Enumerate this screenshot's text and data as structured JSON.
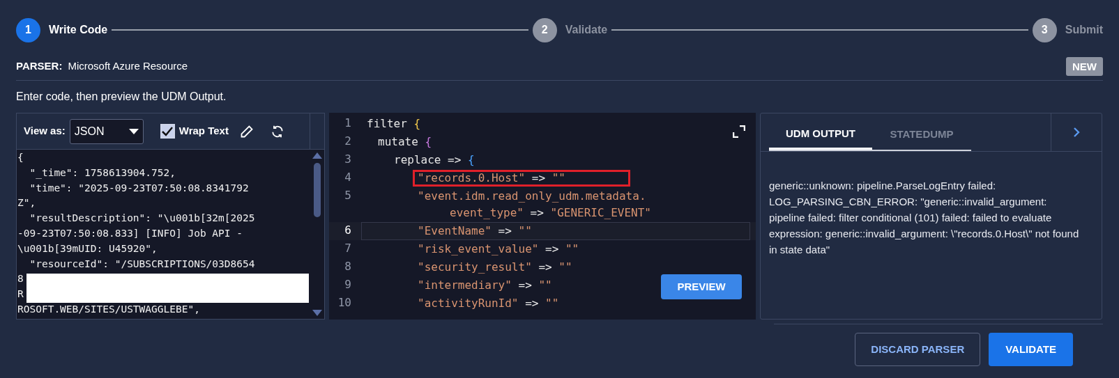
{
  "steps": [
    {
      "number": "1",
      "label": "Write Code",
      "selected": true
    },
    {
      "number": "2",
      "label": "Validate",
      "selected": false
    },
    {
      "number": "3",
      "label": "Submit",
      "selected": false
    }
  ],
  "parser": {
    "label": "PARSER:",
    "value": "Microsoft Azure Resource",
    "badge": "NEW"
  },
  "instruction": "Enter code, then preview the UDM Output.",
  "log_panel": {
    "view_as_label": "View as:",
    "view_as_value": "JSON",
    "wrap_text": {
      "label": "Wrap Text",
      "checked": true
    },
    "lines": [
      "{",
      "  \"_time\": 1758613904.752,",
      "  \"time\": \"2025-09-23T07:50:08.8341792",
      "Z\",",
      "  \"resultDescription\": \"\\u001b[32m[2025",
      "-09-23T07:50:08.833] [INFO] Job API -",
      "\\u001b[39mUID: U45920\",",
      "  \"resourceId\": \"/SUBSCRIPTIONS/03D8654",
      "8",
      "R",
      "ROSOFT.WEB/SITES/USTWAGGLEBE\","
    ]
  },
  "editor": {
    "lines": [
      {
        "number": "1",
        "current": false,
        "highlighted": false,
        "segments": [
          {
            "text": "filter ",
            "kind": "plain"
          },
          {
            "text": "{",
            "kind": "brace1"
          }
        ],
        "children": [
          {
            "number": "2",
            "current": false,
            "highlighted": false,
            "segments": [
              {
                "text": "mutate ",
                "kind": "plain"
              },
              {
                "text": "{",
                "kind": "brace2"
              }
            ],
            "children": [
              {
                "number": "3",
                "current": false,
                "highlighted": false,
                "segments": [
                  {
                    "text": "replace => ",
                    "kind": "plain"
                  },
                  {
                    "text": "{",
                    "kind": "brace3"
                  }
                ],
                "children": [
                  {
                    "number": "4",
                    "current": false,
                    "highlighted": true,
                    "segments": [
                      {
                        "text": "\"records.0.Host\"",
                        "kind": "string"
                      },
                      {
                        "text": " => ",
                        "kind": "plain"
                      },
                      {
                        "text": "\"\"",
                        "kind": "string"
                      }
                    ]
                  },
                  {
                    "number": "5",
                    "current": false,
                    "highlighted": false,
                    "segments": [
                      {
                        "text": "\"event.idm.read_only_udm.metadata.",
                        "kind": "string"
                      }
                    ],
                    "continuation": [
                      {
                        "text": "event_type\"",
                        "kind": "string"
                      },
                      {
                        "text": " => ",
                        "kind": "plain"
                      },
                      {
                        "text": "\"GENERIC_EVENT\"",
                        "kind": "string"
                      }
                    ]
                  },
                  {
                    "number": "6",
                    "current": true,
                    "highlighted": false,
                    "segments": [
                      {
                        "text": "\"EventName\"",
                        "kind": "string"
                      },
                      {
                        "text": " => ",
                        "kind": "plain"
                      },
                      {
                        "text": "\"\"",
                        "kind": "string"
                      }
                    ]
                  },
                  {
                    "number": "7",
                    "current": false,
                    "highlighted": false,
                    "segments": [
                      {
                        "text": "\"risk_event_value\"",
                        "kind": "string"
                      },
                      {
                        "text": " => ",
                        "kind": "plain"
                      },
                      {
                        "text": "\"\"",
                        "kind": "string"
                      }
                    ]
                  },
                  {
                    "number": "8",
                    "current": false,
                    "highlighted": false,
                    "segments": [
                      {
                        "text": "\"security_result\"",
                        "kind": "string"
                      },
                      {
                        "text": " => ",
                        "kind": "plain"
                      },
                      {
                        "text": "\"\"",
                        "kind": "string"
                      }
                    ]
                  },
                  {
                    "number": "9",
                    "current": false,
                    "highlighted": false,
                    "segments": [
                      {
                        "text": "\"intermediary\"",
                        "kind": "string"
                      },
                      {
                        "text": " => ",
                        "kind": "plain"
                      },
                      {
                        "text": "\"\"",
                        "kind": "string"
                      }
                    ]
                  },
                  {
                    "number": "10",
                    "current": false,
                    "highlighted": false,
                    "segments": [
                      {
                        "text": "\"activityRunId\"",
                        "kind": "string"
                      },
                      {
                        "text": " => ",
                        "kind": "plain"
                      },
                      {
                        "text": "\"\"",
                        "kind": "string"
                      }
                    ]
                  }
                ]
              }
            ]
          }
        ]
      }
    ],
    "preview_button": "PREVIEW"
  },
  "output_panel": {
    "tabs": [
      {
        "label": "UDM OUTPUT",
        "selected": true
      },
      {
        "label": "STATEDUMP",
        "selected": false
      }
    ],
    "message": "generic::unknown: pipeline.ParseLogEntry failed: LOG_PARSING_CBN_ERROR: \"generic::invalid_argument: pipeline failed: filter conditional (101) failed: failed to evaluate expression: generic::invalid_argument: \\\"records.0.Host\\\" not found in state data\""
  },
  "footer_buttons": [
    {
      "label": "DISCARD PARSER",
      "kind": "secondary"
    },
    {
      "label": "VALIDATE",
      "kind": "primary"
    }
  ]
}
